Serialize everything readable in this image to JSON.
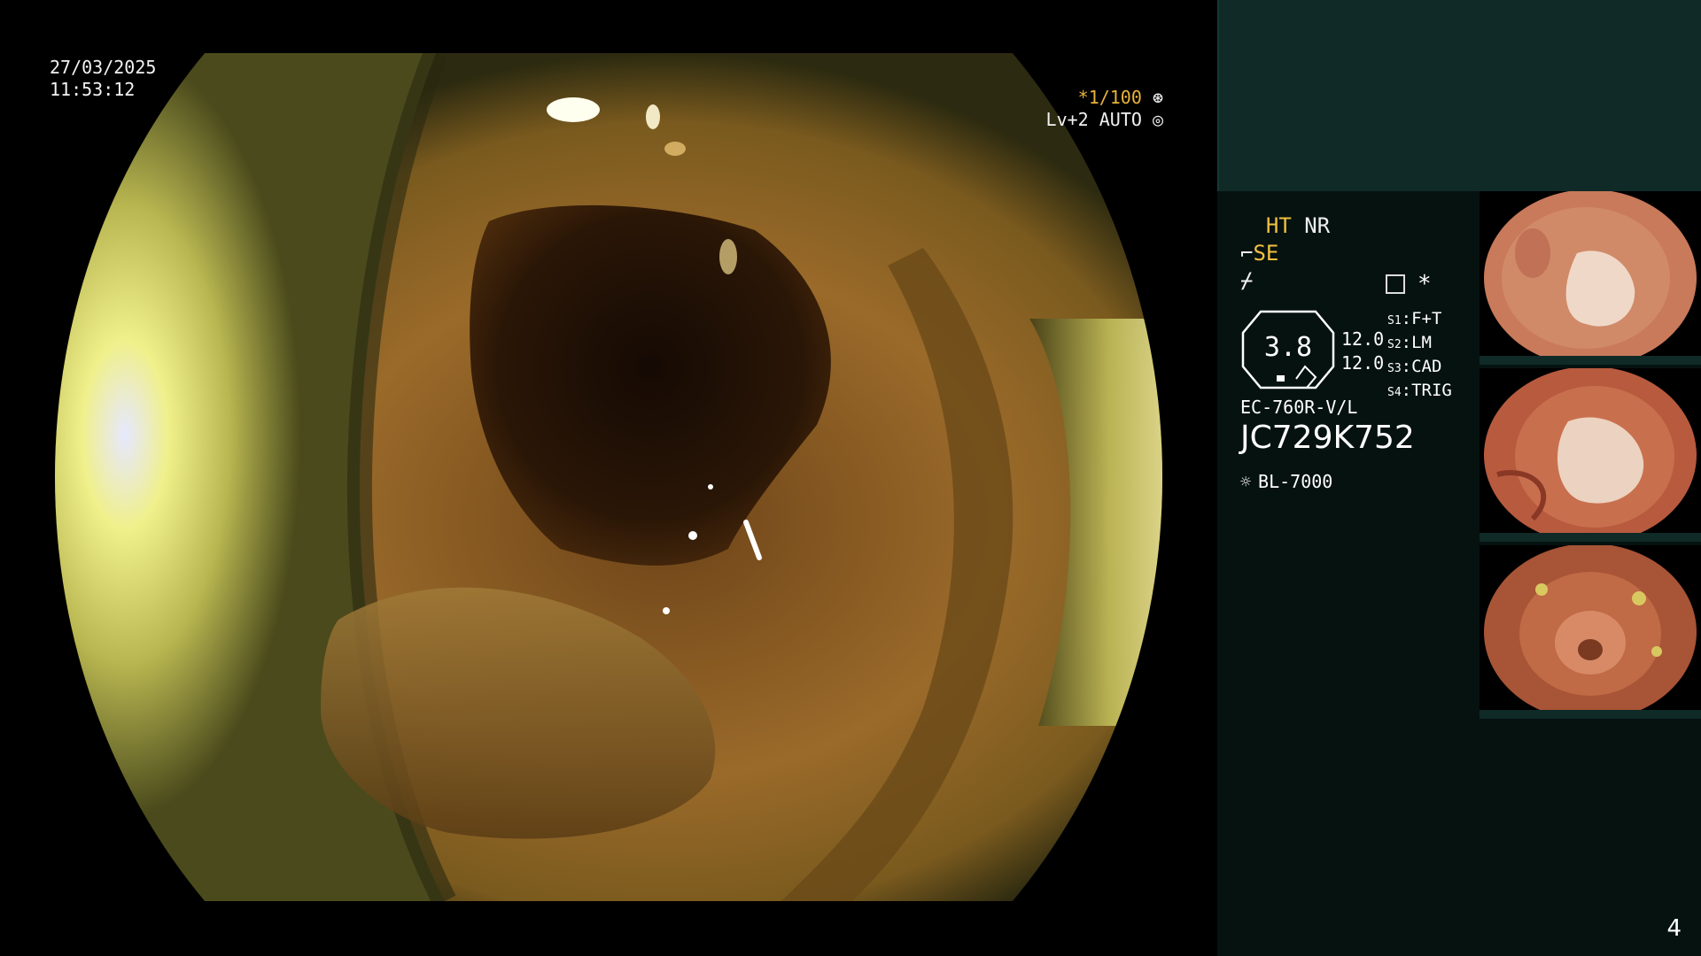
{
  "osd": {
    "date": "27/03/2025",
    "time": "11:53:12",
    "shutter_prefix": "*",
    "shutter": "1/100",
    "iris_line": "Lv+2 AUTO"
  },
  "panel": {
    "ht": "HT",
    "nr": "NR",
    "se": "SE",
    "asterisk": "*",
    "gauge_value": "3.8",
    "gauge_side_1": "12.0",
    "gauge_side_2": "12.0",
    "settings": [
      {
        "key": "S1",
        "value": "F+T"
      },
      {
        "key": "S2",
        "value": "LM"
      },
      {
        "key": "S3",
        "value": "CAD"
      },
      {
        "key": "S4",
        "value": "TRIG"
      }
    ],
    "scope_model": "EC-760R-V/L",
    "serial": "JC729K752",
    "light_source": "BL-7000"
  },
  "page_number": "4",
  "colors": {
    "panel_bg": "#061210",
    "panel_top": "#0f2a27",
    "highlight": "#f0c040"
  },
  "icons": [
    "shutter-iris-icon",
    "auto-iris-icon",
    "structure-enhance-icon",
    "color-mode-icon",
    "menu-list-icon",
    "light-source-icon"
  ]
}
